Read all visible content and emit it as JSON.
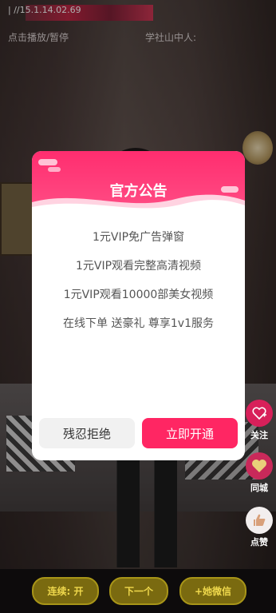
{
  "status_bar": {
    "time": "| //15.1.14.02.69"
  },
  "video_header": {
    "left_text": "点击播放/暂停",
    "right_text": "学社山中人:"
  },
  "modal": {
    "title": "官方公告",
    "lines": [
      "1元VIP免广告弹窗",
      "1元VIP观看完整高清视频",
      "1元VIP观看10000部美女视频",
      "在线下单 送豪礼 尊享1v1服务"
    ],
    "refuse_label": "残忍拒绝",
    "open_label": "立即开通"
  },
  "side_actions": [
    {
      "label": "关注",
      "icon": "heart-plus-icon",
      "color": "#d8205a"
    },
    {
      "label": "同城",
      "icon": "heart-icon",
      "color": "#c9295a"
    },
    {
      "label": "点赞",
      "icon": "thumb-icon",
      "color": "#f2eeee"
    }
  ],
  "bottom_bar": {
    "autoplay_label": "连续: 开",
    "next_label": "下一个",
    "wechat_label": "+她微信"
  }
}
